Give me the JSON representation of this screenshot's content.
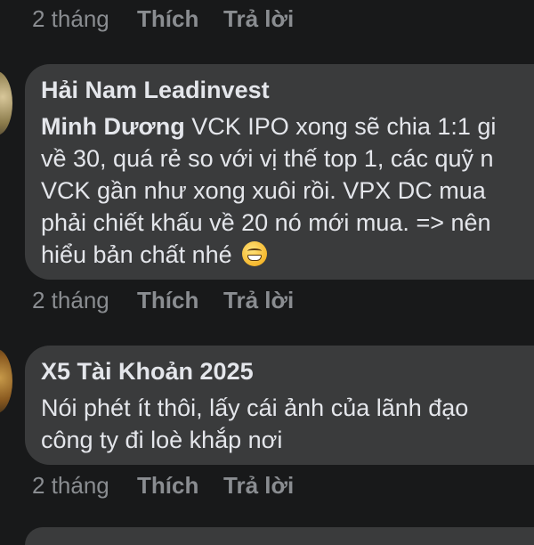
{
  "comments": [
    {
      "actions": {
        "time": "2 tháng",
        "like": "Thích",
        "reply": "Trả lời"
      }
    },
    {
      "author": "Hải Nam Leadinvest",
      "mention": "Minh Dương",
      "lines": [
        "  VCK IPO xong sẽ chia 1:1 gi",
        "về 30, quá rẻ so với vị thế top 1, các quỹ n",
        "VCK gần như xong xuôi rồi. VPX DC mua",
        "phải chiết khấu về 20 nó mới mua. => nên",
        "hiểu bản chất nhé"
      ],
      "emoji": "grinning-face",
      "actions": {
        "time": "2 tháng",
        "like": "Thích",
        "reply": "Trả lời"
      }
    },
    {
      "author": "X5 Tài Khoản 2025",
      "lines": [
        "Nói phét ít thôi, lấy cái ảnh của lãnh đạo",
        "công ty đi loè khắp nơi"
      ],
      "actions": {
        "time": "2 tháng",
        "like": "Thích",
        "reply": "Trả lời"
      }
    }
  ],
  "colors": {
    "background": "#18191a",
    "bubble": "#3a3b3c",
    "text": "#e4e6eb",
    "muted": "#8a8d91"
  }
}
